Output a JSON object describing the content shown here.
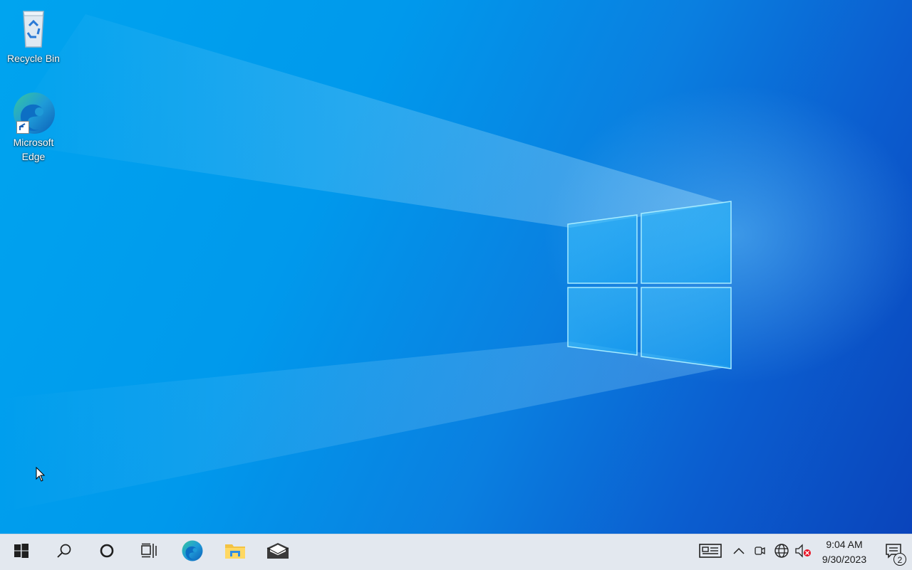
{
  "desktop": {
    "icons": [
      {
        "label": "Recycle Bin",
        "icon": "recycle-bin-icon"
      },
      {
        "label": "Microsoft Edge",
        "icon": "edge-icon"
      }
    ]
  },
  "taskbar": {
    "start_icon": "windows-logo-icon",
    "pinned": [
      "search-icon",
      "cortana-icon",
      "task-view-icon",
      "edge-icon",
      "file-explorer-icon",
      "mail-icon"
    ],
    "tray_icons": [
      "news-widget-icon",
      "chevron-up-icon",
      "meet-now-icon",
      "network-globe-icon",
      "volume-muted-icon"
    ],
    "clock": {
      "time": "9:04 AM",
      "date": "9/30/2023"
    },
    "notifications": {
      "count": "2"
    }
  },
  "colors": {
    "wallpaper_accent": "#00a4ef",
    "taskbar_bg": "#e3e8ef"
  }
}
